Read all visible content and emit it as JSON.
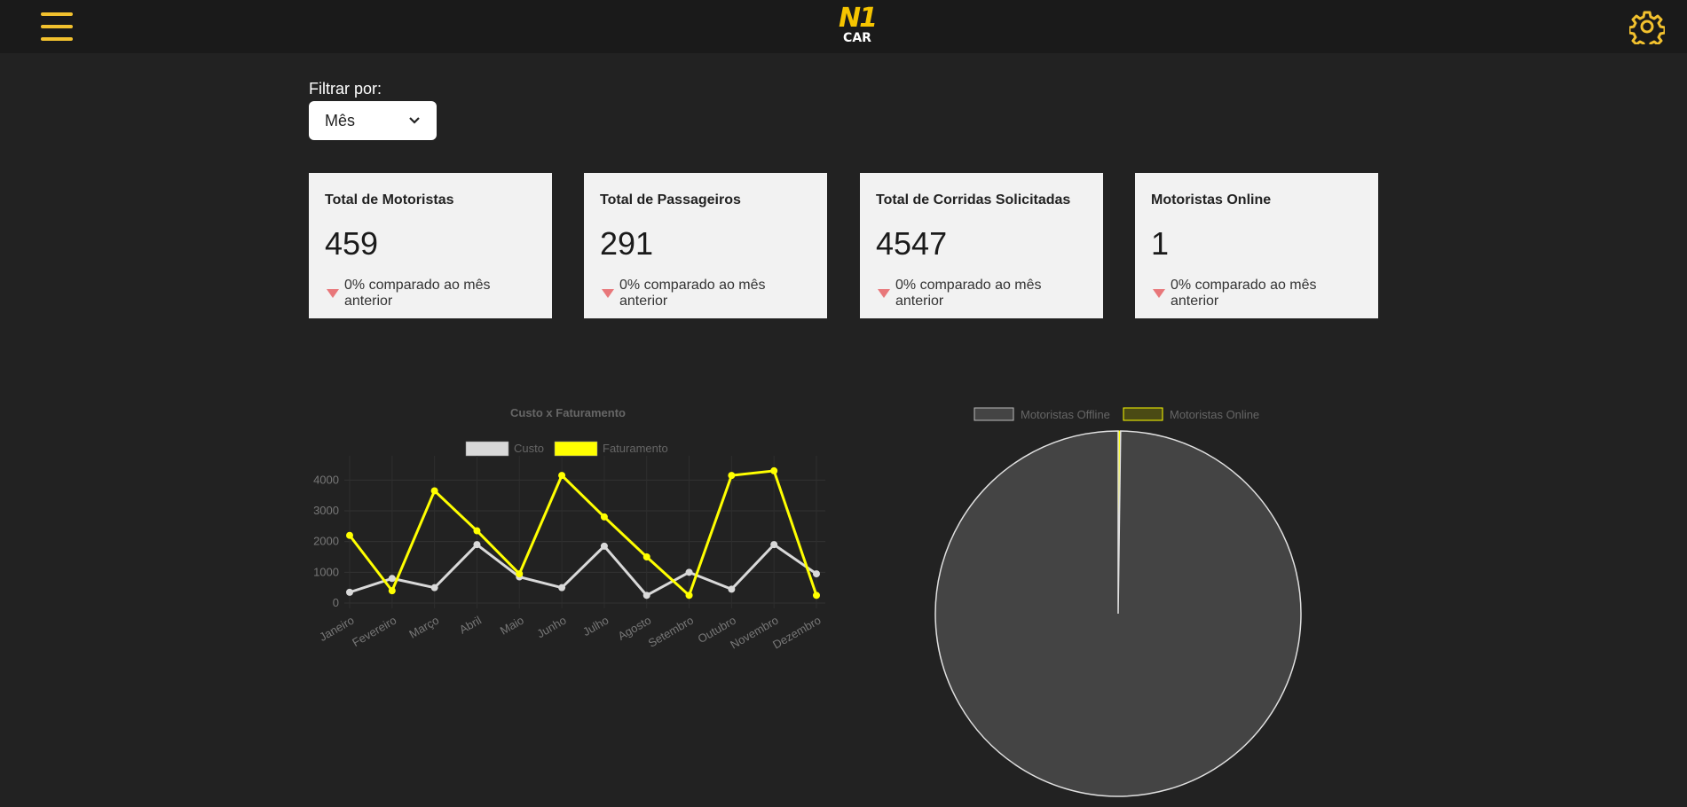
{
  "header": {
    "menu_icon": "hamburger-menu-icon",
    "logo_main": "N1",
    "logo_sub": "CAR",
    "settings_icon": "gear-icon",
    "accent_color": "#f2c12e"
  },
  "filter": {
    "label": "Filtrar por:",
    "selected": "Mês",
    "chevron_icon": "chevron-down-icon"
  },
  "cards": [
    {
      "title": "Total de Motoristas",
      "value": "459",
      "compare": "0% comparado ao mês anterior"
    },
    {
      "title": "Total de Passageiros",
      "value": "291",
      "compare": "0% comparado ao mês anterior"
    },
    {
      "title": "Total de Corridas Solicitadas",
      "value": "4547",
      "compare": "0% comparado ao mês anterior"
    },
    {
      "title": "Motoristas Online",
      "value": "1",
      "compare": "0% comparado ao mês anterior"
    }
  ],
  "chart_data": [
    {
      "type": "line",
      "title": "Custo x Faturamento",
      "categories": [
        "Janeiro",
        "Fevereiro",
        "Março",
        "Abril",
        "Maio",
        "Junho",
        "Julho",
        "Agosto",
        "Setembro",
        "Outubro",
        "Novembro",
        "Dezembro"
      ],
      "series": [
        {
          "name": "Custo",
          "color": "#d9d9d9",
          "values": [
            350,
            800,
            500,
            1900,
            850,
            500,
            1850,
            250,
            1000,
            450,
            1900,
            950
          ]
        },
        {
          "name": "Faturamento",
          "color": "#ffff00",
          "values": [
            2200,
            400,
            3650,
            2350,
            950,
            4150,
            2800,
            1500,
            250,
            4150,
            4300,
            250
          ]
        }
      ],
      "ylim": [
        0,
        4500
      ],
      "yticks": [
        0,
        1000,
        2000,
        3000,
        4000
      ],
      "grid": true,
      "legend": "top"
    },
    {
      "type": "pie",
      "categories": [
        "Motoristas Offline",
        "Motoristas Online"
      ],
      "values": [
        458,
        1
      ],
      "colors": [
        "#444444",
        "#ffff00"
      ],
      "legend": "top"
    }
  ]
}
